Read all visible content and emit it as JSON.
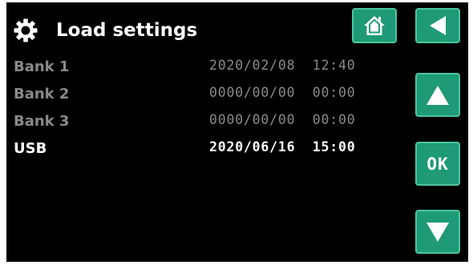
{
  "header": {
    "title": "Load settings",
    "icon": "gear-icon"
  },
  "nav": {
    "home_icon": "home-icon",
    "back_icon": "back-arrow-icon",
    "up_icon": "up-arrow-icon",
    "ok_label": "OK",
    "down_icon": "down-arrow-icon"
  },
  "rows": [
    {
      "name": "Bank 1",
      "date": "2020/02/08  12:40",
      "state": "dim"
    },
    {
      "name": "Bank 2",
      "date": "0000/00/00  00:00",
      "state": "dim"
    },
    {
      "name": "Bank 3",
      "date": "0000/00/00  00:00",
      "state": "dim"
    },
    {
      "name": "USB",
      "date": "2020/06/16  15:00",
      "state": "bright"
    }
  ],
  "colors": {
    "background": "#000000",
    "button": "#1f9a76",
    "button_border": "#4cc6a2",
    "text_active": "#ffffff",
    "text_inactive": "#8a8a8a"
  }
}
